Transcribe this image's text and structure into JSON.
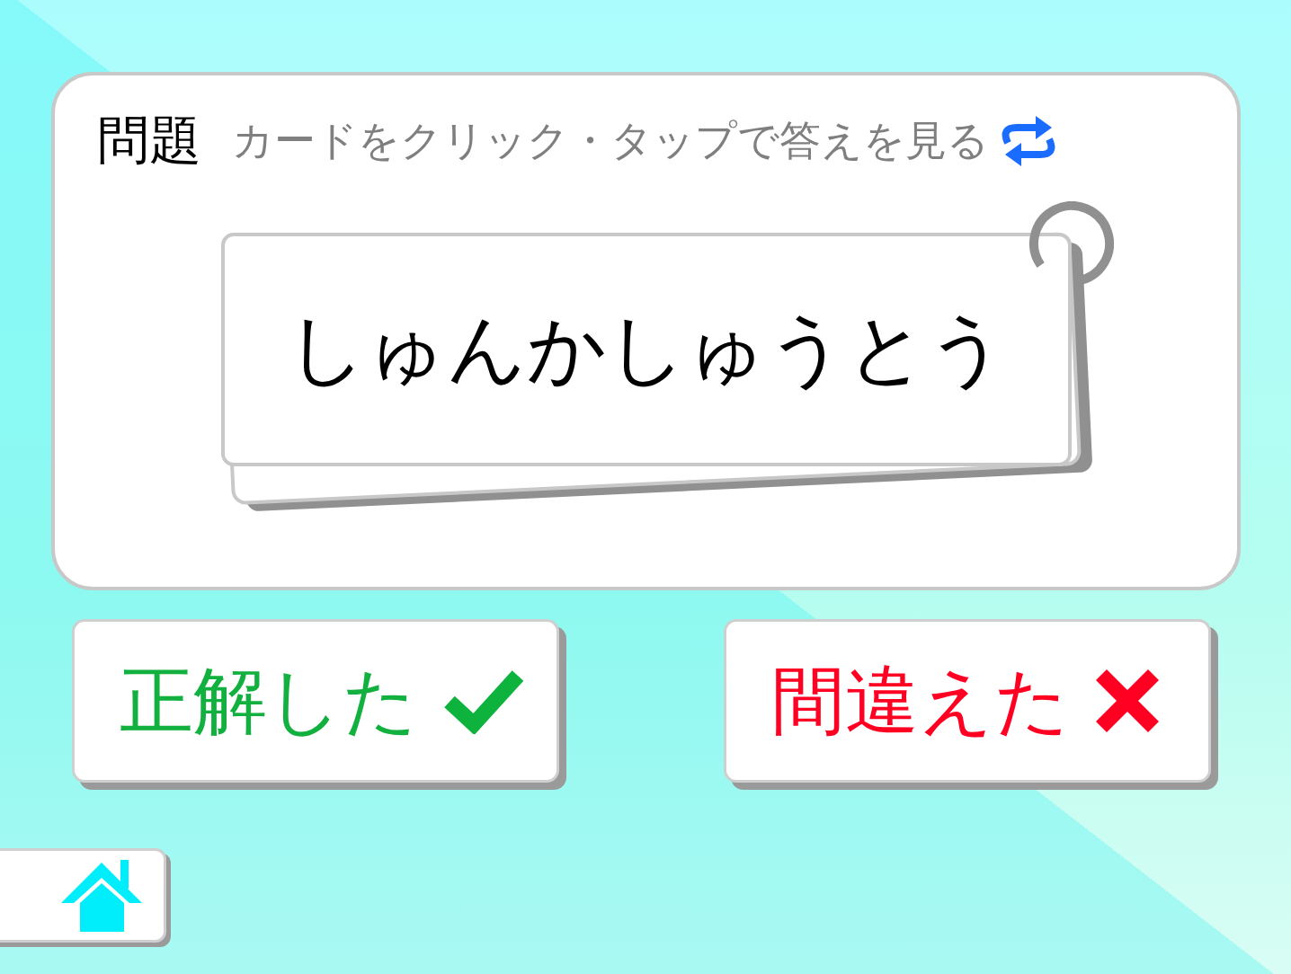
{
  "question_panel": {
    "heading": "問題",
    "hint": "カードをクリック・タップで答えを見る"
  },
  "flashcard": {
    "text": "しゅんかしゅうとう"
  },
  "answer_buttons": [
    {
      "label": "正解した",
      "kind": "correct"
    },
    {
      "label": "間違えた",
      "kind": "wrong"
    }
  ]
}
